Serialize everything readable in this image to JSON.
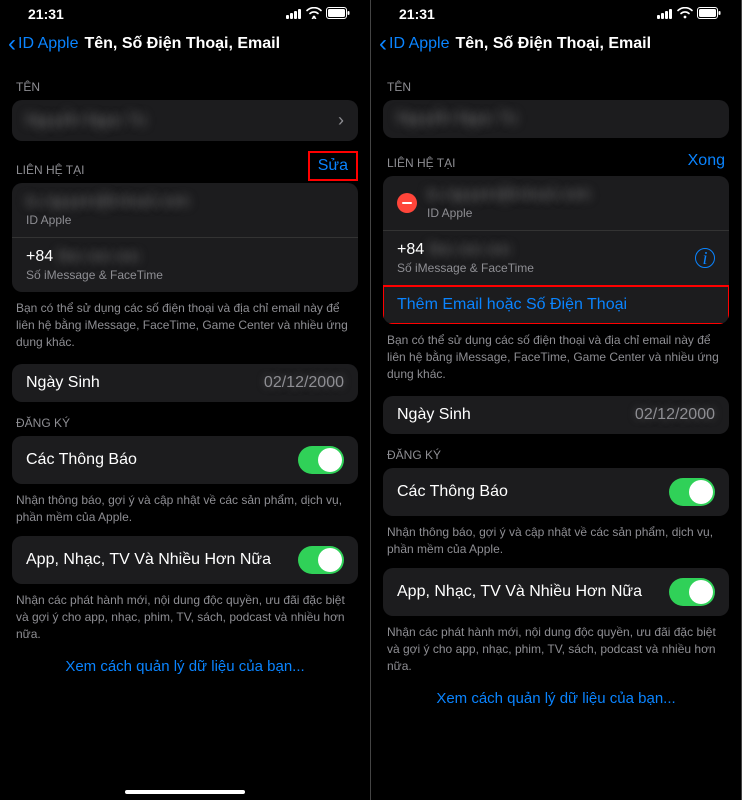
{
  "status": {
    "time": "21:31"
  },
  "nav": {
    "back": "ID Apple",
    "title": "Tên, Số Điện Thoại, Email"
  },
  "sections": {
    "name": {
      "header": "TÊN",
      "value": "Nguyễn Ngọc Tú"
    },
    "contact": {
      "header": "LIÊN HỆ TẠI",
      "edit_action": "Sửa",
      "done_action": "Xong",
      "primary_value": "tu.nguyen@icloud.com",
      "primary_sub": "ID Apple",
      "phone_prefix": "+84",
      "phone_sub": "Số iMessage & FaceTime",
      "add_label": "Thêm Email hoặc Số Điện Thoại",
      "footer": "Bạn có thể sử dụng các số điện thoại và địa chỉ email này để liên hệ bằng iMessage, FaceTime, Game Center và nhiều ứng dụng khác."
    },
    "birthday": {
      "label": "Ngày Sinh",
      "value": "02/12/2000"
    },
    "subscribe": {
      "header": "ĐĂNG KÝ",
      "notify_label": "Các Thông Báo",
      "notify_footer": "Nhận thông báo, gợi ý và cập nhật về các sản phẩm, dịch vụ, phần mềm của Apple.",
      "apps_label": "App, Nhạc, TV Và Nhiều Hơn Nữa",
      "apps_footer": "Nhận các phát hành mới, nội dung độc quyền, ưu đãi đặc biệt và gợi ý cho app, nhạc, phim, TV, sách, podcast và nhiều hơn nữa."
    },
    "manage_link": "Xem cách quản lý dữ liệu của bạn..."
  }
}
